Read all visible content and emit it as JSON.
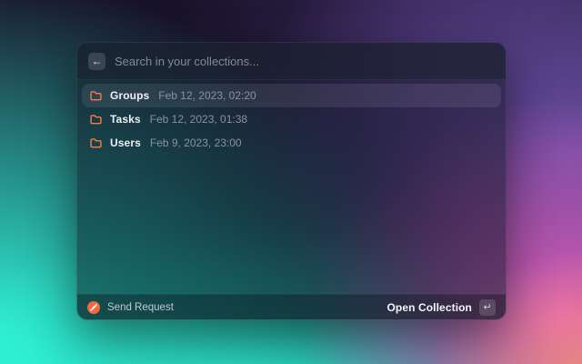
{
  "search": {
    "placeholder": "Search in your collections...",
    "value": "",
    "back_icon": "←"
  },
  "results": [
    {
      "name": "Groups",
      "date": "Feb 12, 2023, 02:20",
      "selected": true
    },
    {
      "name": "Tasks",
      "date": "Feb 12, 2023, 01:38",
      "selected": false
    },
    {
      "name": "Users",
      "date": "Feb 9, 2023, 23:00",
      "selected": false
    }
  ],
  "footer": {
    "send_request_label": "Send Request",
    "open_collection_label": "Open Collection",
    "enter_key_glyph": "↵"
  },
  "colors": {
    "accent_orange": "#fa7b50",
    "brand_circle_orange": "#f4683f",
    "backdrop_teal": "#2ff0d3",
    "backdrop_magenta": "#ec5fc6",
    "backdrop_navy": "#181226"
  }
}
